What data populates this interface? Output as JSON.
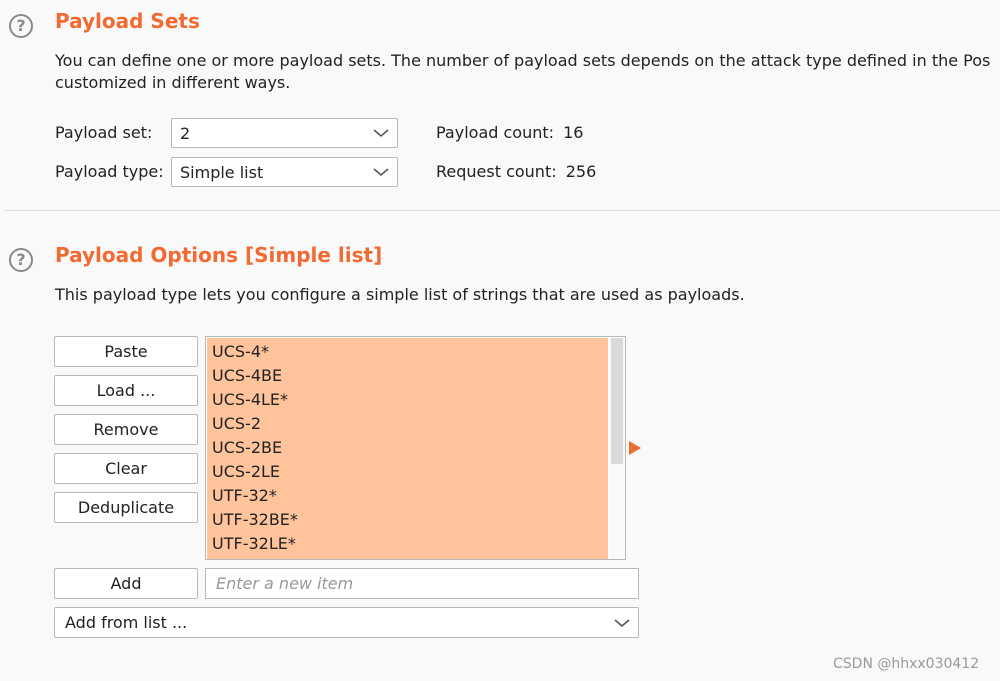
{
  "payload_sets": {
    "title": "Payload Sets",
    "description_line1": "You can define one or more payload sets. The number of payload sets depends on the attack type defined in the Pos",
    "description_line2": "customized in different ways.",
    "set_label": "Payload set:",
    "set_value": "2",
    "type_label": "Payload type:",
    "type_value": "Simple list",
    "count_label": "Payload count:",
    "count_value": "16",
    "request_label": "Request count:",
    "request_value": "256"
  },
  "payload_options": {
    "title": "Payload Options [Simple list]",
    "description": "This payload type lets you configure a simple list of strings that are used as payloads.",
    "buttons": {
      "paste": "Paste",
      "load": "Load ...",
      "remove": "Remove",
      "clear": "Clear",
      "deduplicate": "Deduplicate",
      "add": "Add"
    },
    "items": [
      "UCS-4*",
      "UCS-4BE",
      "UCS-4LE*",
      "UCS-2",
      "UCS-2BE",
      "UCS-2LE",
      "UTF-32*",
      "UTF-32BE*",
      "UTF-32LE*"
    ],
    "new_item_placeholder": "Enter a new item",
    "add_from_list_value": "Add from list ..."
  },
  "watermark": "CSDN @hhxx030412",
  "colors": {
    "accent": "#f06a32",
    "selection": "#ffc49c"
  }
}
